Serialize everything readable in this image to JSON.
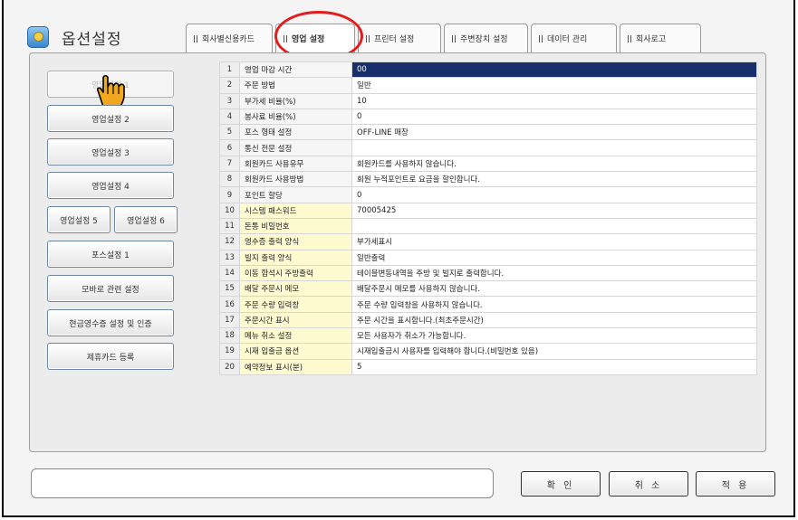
{
  "window": {
    "title": "옵션설정"
  },
  "tabs": [
    {
      "label": "회사별신용카드"
    },
    {
      "label": "영업 설정"
    },
    {
      "label": "프린터 설정"
    },
    {
      "label": "주변장치 설정"
    },
    {
      "label": "데이터 관리"
    },
    {
      "label": "회사로고"
    }
  ],
  "sidebar": {
    "items": [
      {
        "label": "영업설정 1"
      },
      {
        "label": "영업설정 2"
      },
      {
        "label": "영업설정 3"
      },
      {
        "label": "영업설정 4"
      },
      {
        "label": "영업설정 5"
      },
      {
        "label": "영업설정 6"
      },
      {
        "label": "포스설정 1"
      },
      {
        "label": "모바로 관련 설정"
      },
      {
        "label": "현금영수증 설정 및 인증"
      },
      {
        "label": "제휴카드 등록"
      }
    ]
  },
  "settings": {
    "rows": [
      {
        "no": "1",
        "label": "영업 마감 시간",
        "value": "00"
      },
      {
        "no": "2",
        "label": "주문 방법",
        "value": "일반"
      },
      {
        "no": "3",
        "label": "부가세 비율(%)",
        "value": "10"
      },
      {
        "no": "4",
        "label": "봉사료 비율(%)",
        "value": "0"
      },
      {
        "no": "5",
        "label": "포스 형태 설정",
        "value": "OFF-LINE 매장"
      },
      {
        "no": "6",
        "label": "통신 전문 설정",
        "value": ""
      },
      {
        "no": "7",
        "label": "회원카드 사용유무",
        "value": "회원카드를 사용하지 않습니다."
      },
      {
        "no": "8",
        "label": "회원카드 사용방법",
        "value": "회원 누적포인트로 요금을 할인합니다."
      },
      {
        "no": "9",
        "label": "포인트 할당",
        "value": "0"
      },
      {
        "no": "10",
        "label": "시스템 패스워드",
        "value": "70005425"
      },
      {
        "no": "11",
        "label": "돈통 비밀번호",
        "value": ""
      },
      {
        "no": "12",
        "label": "영수증 출력 양식",
        "value": "부가세표시"
      },
      {
        "no": "13",
        "label": "빌지 출력 양식",
        "value": "일반출력"
      },
      {
        "no": "14",
        "label": "이동 합석시 주방출력",
        "value": "테이블변동내역을 주방 및 빌지로 출력합니다."
      },
      {
        "no": "15",
        "label": "배달 주문시 메모",
        "value": "배달주문시 메모를 사용하지 않습니다."
      },
      {
        "no": "16",
        "label": "주문 수량 입력창",
        "value": "주문 수량 입력창을 사용하지 않습니다."
      },
      {
        "no": "17",
        "label": "주문시간 표시",
        "value": "주문 시간을 표시합니다.(최초주문시간)"
      },
      {
        "no": "18",
        "label": "메뉴 취소 설정",
        "value": "모든 사용자가 취소가 가능합니다."
      },
      {
        "no": "19",
        "label": "시재 입출금 옵션",
        "value": "시재입출금시 사용자를 입력해야 합니다.(비밀번호 있음)"
      },
      {
        "no": "20",
        "label": "예약정보 표시(분)",
        "value": "5"
      }
    ]
  },
  "status": {
    "text": ""
  },
  "footer": {
    "ok_label": "확 인",
    "cancel_label": "취 소",
    "apply_label": "적 용"
  },
  "colors": {
    "highlight_ring": "#e21d1d",
    "selected_cell": "#17306b",
    "yellow_label": "#fffbd0"
  }
}
